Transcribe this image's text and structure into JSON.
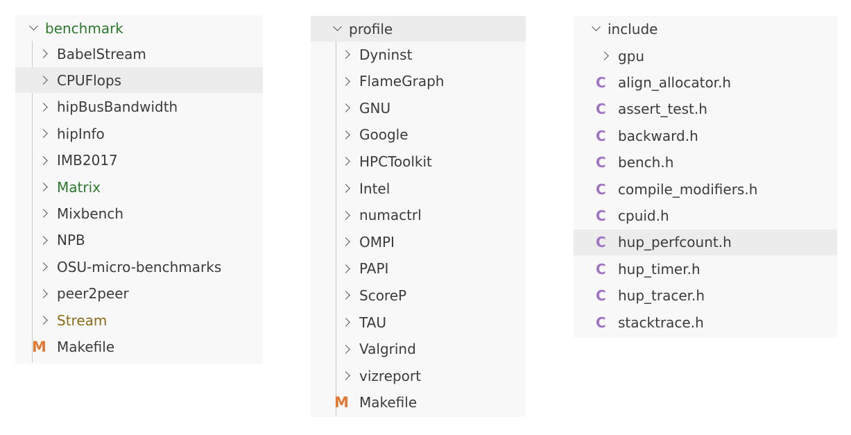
{
  "benchmark": {
    "root": "benchmark",
    "items": [
      {
        "label": "BabelStream",
        "kind": "folder",
        "color": "default"
      },
      {
        "label": "CPUFlops",
        "kind": "folder",
        "color": "default",
        "selected": true
      },
      {
        "label": "hipBusBandwidth",
        "kind": "folder",
        "color": "default"
      },
      {
        "label": "hipInfo",
        "kind": "folder",
        "color": "default"
      },
      {
        "label": "IMB2017",
        "kind": "folder",
        "color": "default"
      },
      {
        "label": "Matrix",
        "kind": "folder",
        "color": "green"
      },
      {
        "label": "Mixbench",
        "kind": "folder",
        "color": "default"
      },
      {
        "label": "NPB",
        "kind": "folder",
        "color": "default"
      },
      {
        "label": "OSU-micro-benchmarks",
        "kind": "folder",
        "color": "default"
      },
      {
        "label": "peer2peer",
        "kind": "folder",
        "color": "default"
      },
      {
        "label": "Stream",
        "kind": "folder",
        "color": "olive"
      },
      {
        "label": "Makefile",
        "kind": "makefile",
        "icon_glyph": "M"
      }
    ]
  },
  "profile": {
    "root": "profile",
    "items": [
      {
        "label": "Dyninst",
        "kind": "folder"
      },
      {
        "label": "FlameGraph",
        "kind": "folder"
      },
      {
        "label": "GNU",
        "kind": "folder"
      },
      {
        "label": "Google",
        "kind": "folder"
      },
      {
        "label": "HPCToolkit",
        "kind": "folder"
      },
      {
        "label": "Intel",
        "kind": "folder"
      },
      {
        "label": "numactrl",
        "kind": "folder"
      },
      {
        "label": "OMPI",
        "kind": "folder"
      },
      {
        "label": "PAPI",
        "kind": "folder"
      },
      {
        "label": "ScoreP",
        "kind": "folder"
      },
      {
        "label": "TAU",
        "kind": "folder"
      },
      {
        "label": "Valgrind",
        "kind": "folder"
      },
      {
        "label": "vizreport",
        "kind": "folder"
      },
      {
        "label": "Makefile",
        "kind": "makefile",
        "icon_glyph": "M"
      }
    ]
  },
  "include": {
    "root": "include",
    "items": [
      {
        "label": "gpu",
        "kind": "folder"
      },
      {
        "label": "align_allocator.h",
        "kind": "c-header",
        "icon_glyph": "C"
      },
      {
        "label": "assert_test.h",
        "kind": "c-header",
        "icon_glyph": "C"
      },
      {
        "label": "backward.h",
        "kind": "c-header",
        "icon_glyph": "C"
      },
      {
        "label": "bench.h",
        "kind": "c-header",
        "icon_glyph": "C"
      },
      {
        "label": "compile_modifiers.h",
        "kind": "c-header",
        "icon_glyph": "C"
      },
      {
        "label": "cpuid.h",
        "kind": "c-header",
        "icon_glyph": "C"
      },
      {
        "label": "hup_perfcount.h",
        "kind": "c-header",
        "icon_glyph": "C",
        "selected": true
      },
      {
        "label": "hup_timer.h",
        "kind": "c-header",
        "icon_glyph": "C"
      },
      {
        "label": "hup_tracer.h",
        "kind": "c-header",
        "icon_glyph": "C"
      },
      {
        "label": "stacktrace.h",
        "kind": "c-header",
        "icon_glyph": "C"
      }
    ]
  },
  "colors": {
    "panel_bg": "#f8f8f8",
    "selected_bg": "#ececec",
    "text": "#3b3b3b",
    "green_label": "#2b7a2b",
    "olive_label": "#8a6d1a",
    "makefile_icon": "#e37933",
    "c_icon": "#a074c4"
  }
}
